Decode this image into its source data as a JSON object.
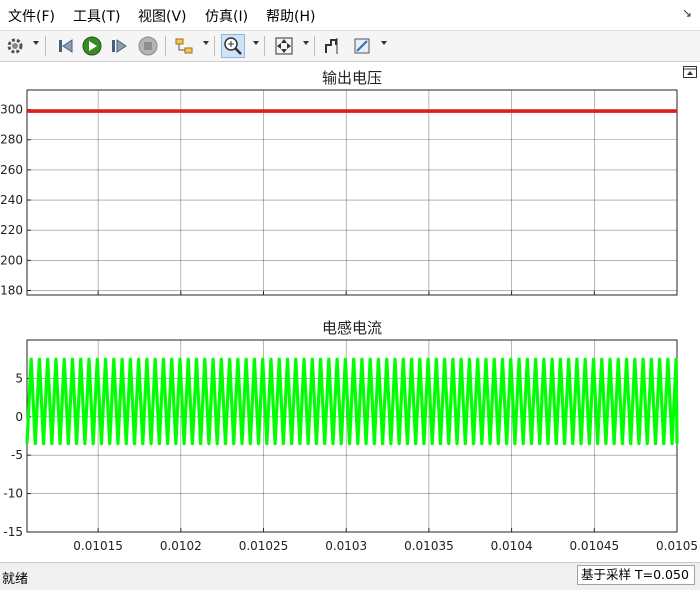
{
  "menu": {
    "items": [
      "文件(F)",
      "工具(T)",
      "视图(V)",
      "仿真(I)",
      "帮助(H)"
    ]
  },
  "toolbar": {
    "icons": [
      "settings-icon",
      "step-back-icon",
      "run-icon",
      "step-forward-icon",
      "stop-icon",
      "highlight-block-icon",
      "zoom-in-icon",
      "fit-view-icon",
      "cursor-measure-icon",
      "signal-statistics-icon"
    ]
  },
  "status": {
    "text": "就绪",
    "sample": "基于采样",
    "time": "T=0.050"
  },
  "colors": {
    "voltage": "#e41a1a",
    "current": "#00ff00"
  },
  "chart_data": [
    {
      "type": "line",
      "title": "输出电压",
      "x": [
        0.010107,
        0.0105
      ],
      "series": [
        {
          "values": [
            299,
            299
          ]
        }
      ],
      "xlim": [
        0.010107,
        0.0105
      ],
      "ylim": [
        177,
        313
      ],
      "yticks": [
        180,
        200,
        220,
        240,
        260,
        280,
        300
      ],
      "yticklabels": [
        "180",
        "200",
        "220",
        "240",
        "260",
        "280",
        "300"
      ],
      "xticks": [
        0.01015,
        0.0102,
        0.01025,
        0.0103,
        0.01035,
        0.0104,
        0.01045,
        0.0105
      ],
      "xticklabels": [],
      "grid": true
    },
    {
      "type": "line",
      "title": "电感电流",
      "x_note": "triangular ripple",
      "ripple": {
        "min": -3.5,
        "max": 7.5,
        "period": 5e-06
      },
      "xlim": [
        0.010107,
        0.0105
      ],
      "ylim": [
        -15,
        10
      ],
      "yticks": [
        -15,
        -10,
        -5,
        0,
        5
      ],
      "yticklabels": [
        "-15",
        "-10",
        "-5",
        "0",
        "5"
      ],
      "xticks": [
        0.01015,
        0.0102,
        0.01025,
        0.0103,
        0.01035,
        0.0104,
        0.01045,
        0.0105
      ],
      "xticklabels": [
        "0.01015",
        "0.0102",
        "0.01025",
        "0.0103",
        "0.01035",
        "0.0104",
        "0.01045",
        "0.0105"
      ],
      "grid": true
    }
  ]
}
